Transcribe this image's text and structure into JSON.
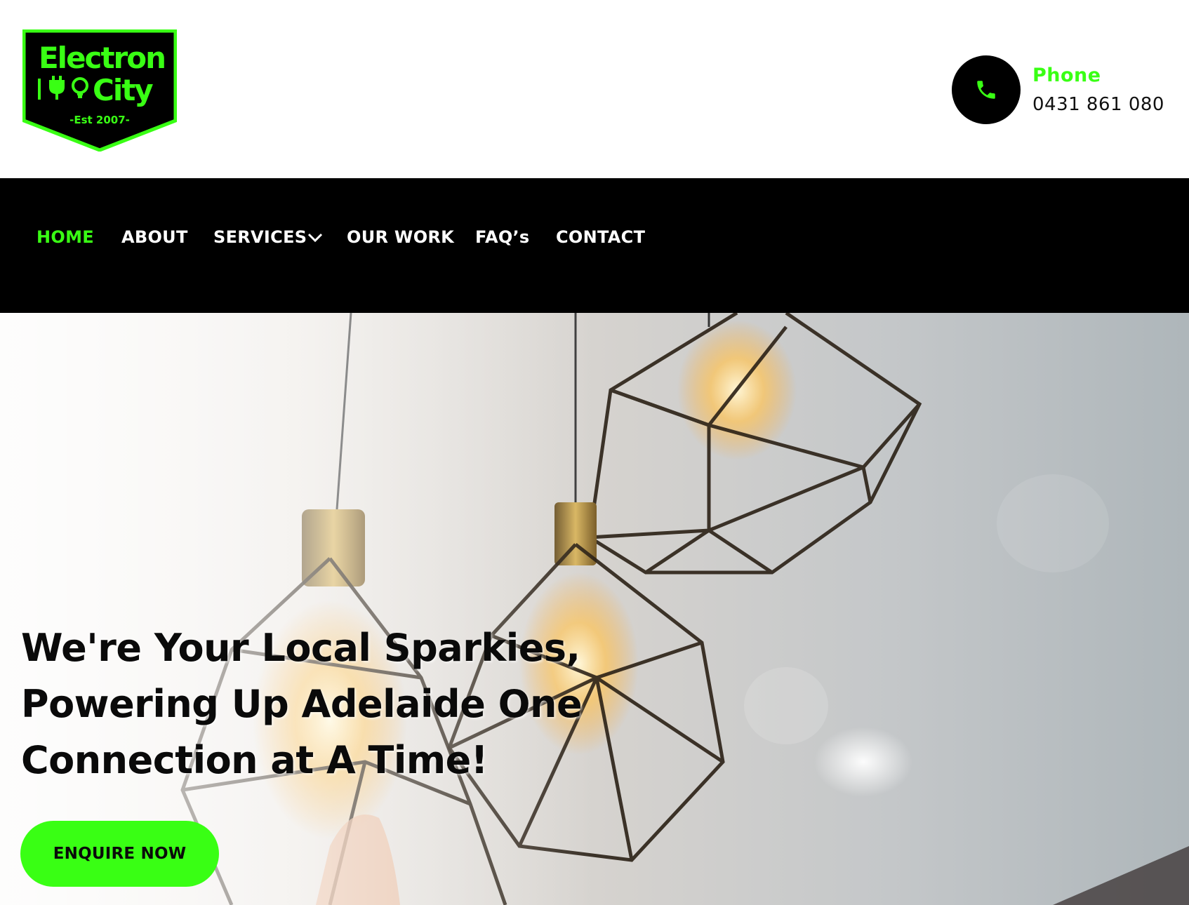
{
  "brand": {
    "logo_line1": "Electron",
    "logo_line2": "City",
    "logo_est": "-Est 2007-",
    "accent_color": "#39ff14"
  },
  "contact": {
    "icon": "phone-icon",
    "label": "Phone",
    "number": "0431 861 080"
  },
  "nav": {
    "items": [
      {
        "label": "HOME",
        "active": true
      },
      {
        "label": "ABOUT"
      },
      {
        "label": "SERVICES",
        "has_dropdown": true
      },
      {
        "label": "OUR WORK"
      },
      {
        "label": "FAQ’s"
      },
      {
        "label": "CONTACT"
      }
    ]
  },
  "hero": {
    "heading_line1": "We're Your Local Sparkies,",
    "heading_line2": "Powering Up Adelaide One",
    "heading_line3": "Connection at A Time!",
    "cta_label": "ENQUIRE NOW",
    "image": "pendant-light-bulbs-photo"
  }
}
